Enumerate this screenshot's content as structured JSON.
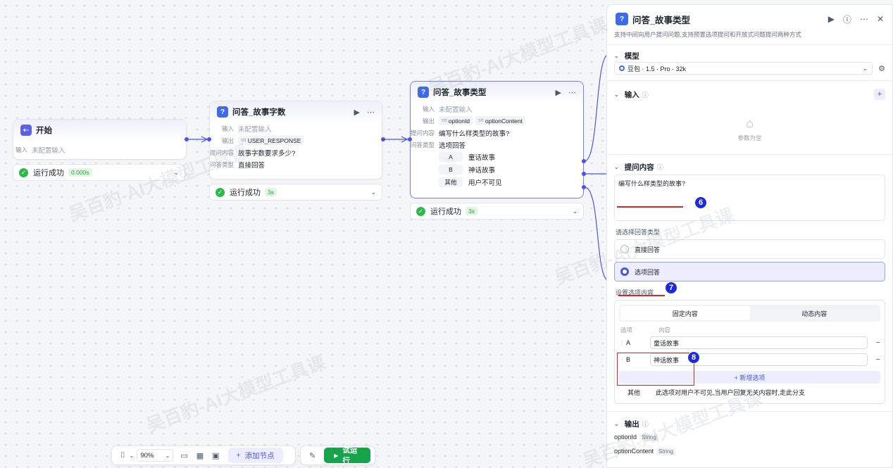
{
  "watermark": "吴百豹-AI大模型工具课",
  "nodes": {
    "start": {
      "title": "开始",
      "input_key": "输入",
      "input_value": "未配置输入",
      "status": "运行成功",
      "time": "0.000s"
    },
    "qa1": {
      "title": "问答_故事字数",
      "input_key": "输入",
      "input_value": "未配置输入",
      "output_key": "输出",
      "output_type": "str",
      "output_value": "USER_RESPONSE",
      "question_key": "提问内容",
      "question_value": "故事字数要求多少?",
      "answer_type_key": "问答类型",
      "answer_type_value": "直接回答",
      "status": "运行成功",
      "time": "3s"
    },
    "qa2": {
      "title": "问答_故事类型",
      "input_key": "输入",
      "input_value": "未配置输入",
      "output_key": "输出",
      "output_type": "str",
      "output1": "optionId",
      "output2": "optionContent",
      "question_key": "提问内容",
      "question_value": "编写什么样类型的故事?",
      "answer_type_key": "问答类型",
      "answer_type_value": "选项回答",
      "options": [
        {
          "key": "A",
          "value": "童话故事"
        },
        {
          "key": "B",
          "value": "神话故事"
        },
        {
          "key": "其他",
          "value": "用户不可见"
        }
      ],
      "status": "运行成功",
      "time": "3s"
    }
  },
  "toolbar": {
    "zoom": "90%",
    "add_node": "添加节点",
    "run": "试运行"
  },
  "panel": {
    "title": "问答_故事类型",
    "description": "支持中间向用户提问问题,支持预置选项提问和开放式问题提问两种方式",
    "model_section": "模型",
    "model_value": "豆包 · 1.5 · Pro · 32k",
    "input_section": "输入",
    "input_empty": "参数为空",
    "question_section": "提问内容",
    "question_value": "编写什么样类型的故事?",
    "answer_type_label": "请选择回答类型",
    "answer_direct": "直接回答",
    "answer_option": "选项回答",
    "option_setting_label": "设置选项内容",
    "seg_fixed": "固定内容",
    "seg_dynamic": "动态内容",
    "col_option": "选项",
    "col_content": "内容",
    "options": [
      {
        "key": "A",
        "value": "童话故事"
      },
      {
        "key": "B",
        "value": "神话故事"
      }
    ],
    "add_option": "+ 新增选项",
    "other_key": "其他",
    "other_desc": "此选项对用户不可见,当用户回复无关内容时,走此分支",
    "output_section": "输出",
    "outputs": [
      {
        "name": "optionId",
        "type": "String"
      },
      {
        "name": "optionContent",
        "type": "String"
      }
    ]
  },
  "annotations": {
    "badge6": "6",
    "badge7": "7",
    "badge8": "8"
  }
}
